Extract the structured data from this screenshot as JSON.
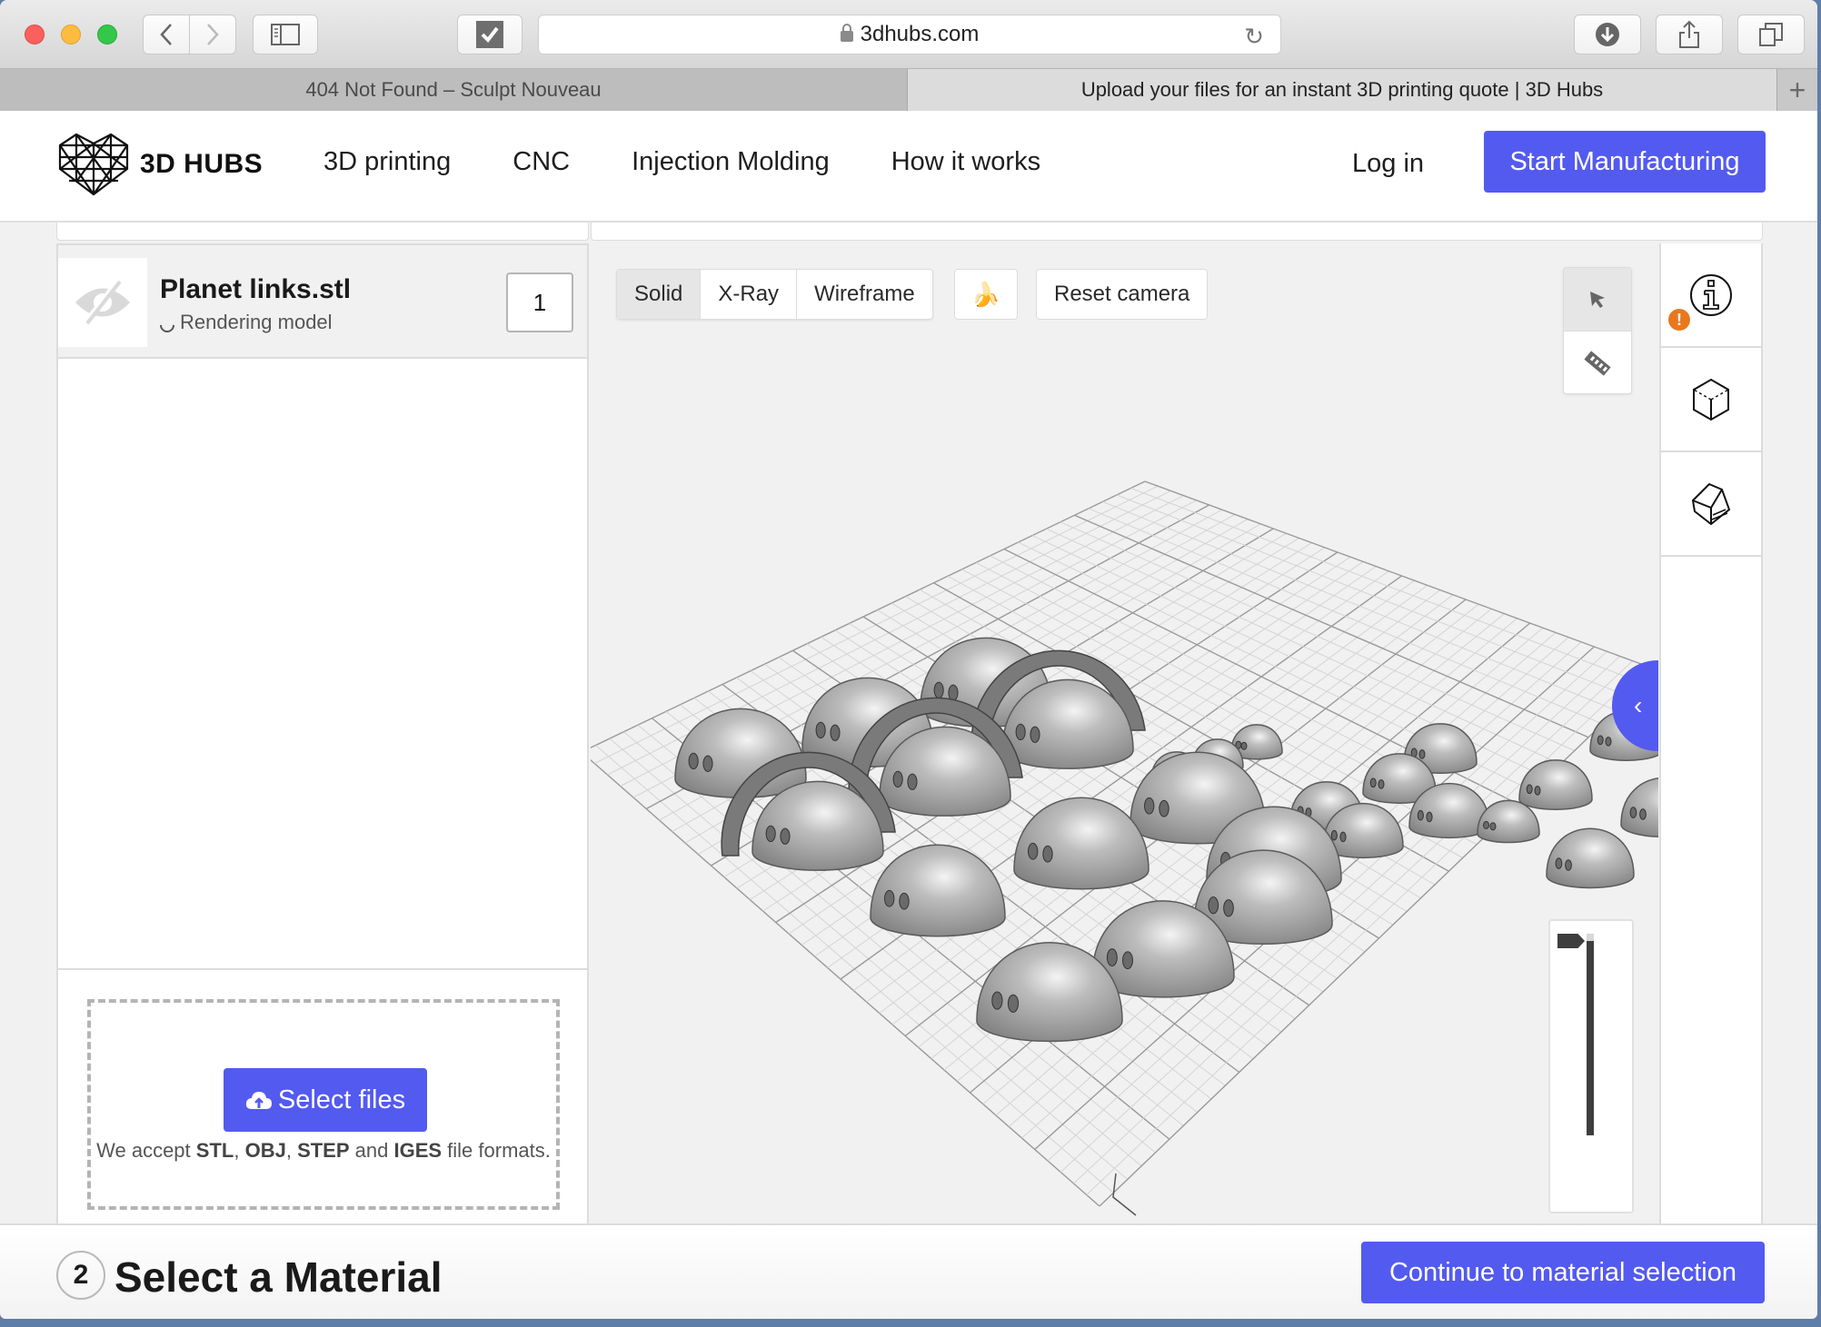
{
  "browser": {
    "url": "3dhubs.com",
    "tabs": [
      {
        "title": "404 Not Found – Sculpt Nouveau",
        "active": false
      },
      {
        "title": "Upload your files for an instant 3D printing quote | 3D Hubs",
        "active": true
      }
    ],
    "new_tab_label": "+",
    "icons": {
      "back": "chevron-left-icon",
      "forward": "chevron-right-icon",
      "sidebar": "sidebar-icon",
      "extension": "checkbox-icon",
      "reload": "reload-icon",
      "downloads": "download-icon",
      "share": "share-icon",
      "tabs": "tabs-overview-icon"
    }
  },
  "header": {
    "logo_text": "3D HUBS",
    "nav": [
      {
        "label": "3D printing"
      },
      {
        "label": "CNC"
      },
      {
        "label": "Injection Molding"
      },
      {
        "label": "How it works"
      }
    ],
    "login_label": "Log in",
    "cta_label": "Start Manufacturing"
  },
  "files": {
    "items": [
      {
        "name": "Planet links.stl",
        "status": "Rendering model",
        "quantity": "1",
        "thumbnail_icon": "eye-off-icon"
      }
    ]
  },
  "upload": {
    "button_label": "Select files",
    "button_icon": "cloud-upload-icon",
    "accept_prefix": "We accept ",
    "formats": [
      "STL",
      "OBJ",
      "STEP",
      "IGES"
    ],
    "sep1": ", ",
    "sep2": ", ",
    "sep3": " and ",
    "accept_suffix": " file formats."
  },
  "viewer": {
    "modes": [
      {
        "label": "Solid",
        "active": true
      },
      {
        "label": "X-Ray",
        "active": false
      },
      {
        "label": "Wireframe",
        "active": false
      }
    ],
    "banana_label": "🍌",
    "reset_label": "Reset camera",
    "tools": [
      {
        "icon": "pointer-icon",
        "active": true
      },
      {
        "icon": "ruler-icon",
        "active": false
      }
    ],
    "collapse_label": "‹",
    "layer_slider": {
      "value": 1.0
    }
  },
  "sidebar": {
    "tiles": [
      {
        "icon": "info-icon",
        "warning": "!"
      },
      {
        "icon": "cube-icon"
      },
      {
        "icon": "cube-section-icon"
      }
    ],
    "accent": "#535aef",
    "warning_color": "#e8781d"
  },
  "footer": {
    "step_number": "2",
    "step_title": "Select a Material",
    "continue_label": "Continue to material selection"
  }
}
